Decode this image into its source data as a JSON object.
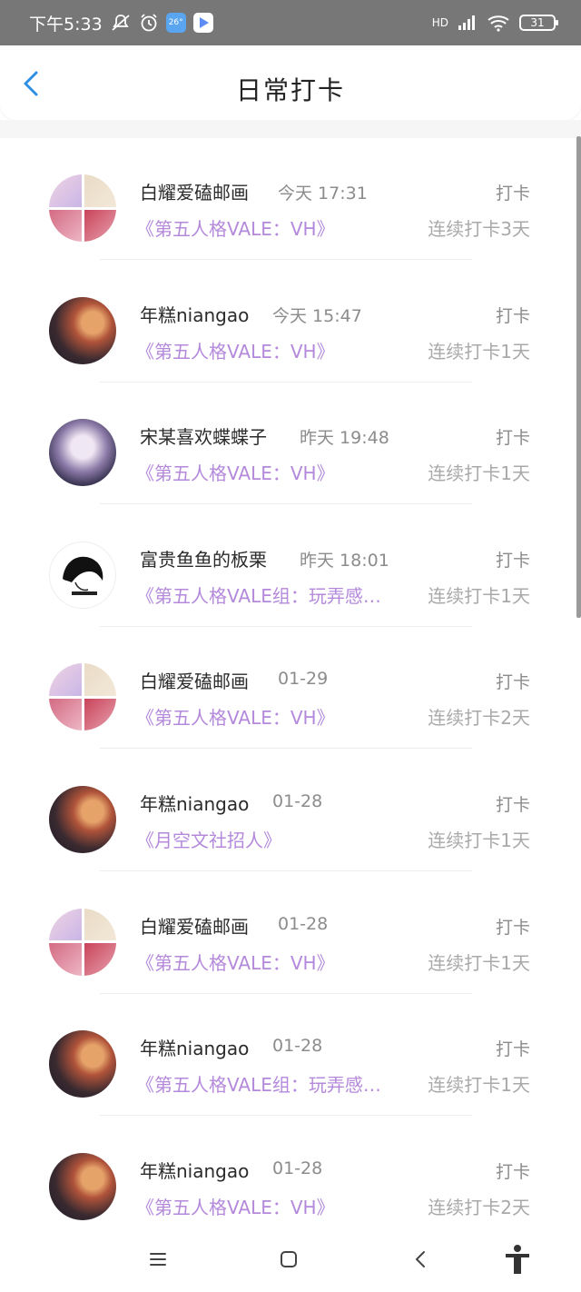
{
  "status_bar": {
    "time": "下午5:33",
    "weather_temp": "26°",
    "network": "HD",
    "battery": "31"
  },
  "header": {
    "title": "日常打卡"
  },
  "entries": [
    {
      "name": "白耀爱磕邮画",
      "time": "今天 17:31",
      "tag": "打卡",
      "book": "《第五人格VALE：VH》",
      "streak": "连续打卡3天"
    },
    {
      "name": "年糕niangao",
      "time": "今天 15:47",
      "tag": "打卡",
      "book": "《第五人格VALE：VH》",
      "streak": "连续打卡1天"
    },
    {
      "name": "宋某喜欢蝶蝶子",
      "time": "昨天 19:48",
      "tag": "打卡",
      "book": "《第五人格VALE：VH》",
      "streak": "连续打卡1天"
    },
    {
      "name": "富贵鱼鱼的板栗",
      "time": "昨天 18:01",
      "tag": "打卡",
      "book": "《第五人格VALE组：玩弄感…",
      "streak": "连续打卡1天"
    },
    {
      "name": "白耀爱磕邮画",
      "time": "01-29",
      "tag": "打卡",
      "book": "《第五人格VALE：VH》",
      "streak": "连续打卡2天"
    },
    {
      "name": "年糕niangao",
      "time": "01-28",
      "tag": "打卡",
      "book": "《月空文社招人》",
      "streak": "连续打卡1天"
    },
    {
      "name": "白耀爱磕邮画",
      "time": "01-28",
      "tag": "打卡",
      "book": "《第五人格VALE：VH》",
      "streak": "连续打卡1天"
    },
    {
      "name": "年糕niangao",
      "time": "01-28",
      "tag": "打卡",
      "book": "《第五人格VALE组：玩弄感…",
      "streak": "连续打卡1天"
    },
    {
      "name": "年糕niangao",
      "time": "01-28",
      "tag": "打卡",
      "book": "《第五人格VALE：VH》",
      "streak": "连续打卡2天"
    }
  ],
  "nav": {
    "menu_icon": "menu-icon",
    "home_icon": "home-icon",
    "back_icon": "back-icon",
    "accessibility_icon": "accessibility-icon"
  },
  "colors": {
    "accent_blue": "#2f8fe3",
    "book_purple": "#b489db",
    "status_gray": "#777777"
  }
}
